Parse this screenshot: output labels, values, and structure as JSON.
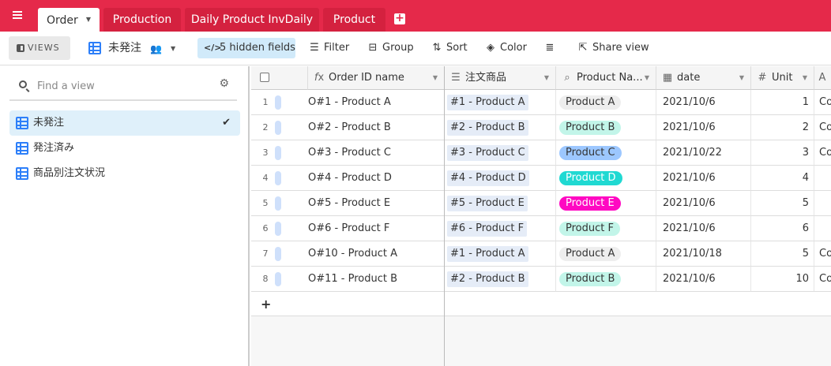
{
  "tabs": [
    {
      "label": "Order",
      "active": true
    },
    {
      "label": "Production",
      "active": false
    },
    {
      "label": "Daily Product InvDaily",
      "active": false
    },
    {
      "label": "Product",
      "active": false
    }
  ],
  "toolbar": {
    "views_label": "VIEWS",
    "view_name": "未発注",
    "hidden_fields": "5 hidden fields",
    "filter": "Filter",
    "group": "Group",
    "sort": "Sort",
    "color": "Color",
    "share": "Share view"
  },
  "sidebar": {
    "search_placeholder": "Find a view",
    "views": [
      {
        "label": "未発注",
        "active": true
      },
      {
        "label": "発注済み",
        "active": false
      },
      {
        "label": "商品別注文状況",
        "active": false
      }
    ]
  },
  "columns": [
    {
      "label": "Order ID name",
      "icon": "formula-icon"
    },
    {
      "label": "注文商品",
      "icon": "link-icon"
    },
    {
      "label": "Product Na...",
      "icon": "lookup-icon"
    },
    {
      "label": "date",
      "icon": "calendar-icon"
    },
    {
      "label": "Unit",
      "icon": "number-icon"
    },
    {
      "label": "",
      "icon": "text-icon"
    }
  ],
  "rows": [
    {
      "num": "1",
      "order": "O#1 - Product A",
      "link": "#1 - Product A",
      "product": "Product A",
      "date": "2021/10/6",
      "unit": "1",
      "extra": "Co"
    },
    {
      "num": "2",
      "order": "O#2 - Product B",
      "link": "#2 - Product B",
      "product": "Product B",
      "date": "2021/10/6",
      "unit": "2",
      "extra": "Co"
    },
    {
      "num": "3",
      "order": "O#3 - Product C",
      "link": "#3 - Product C",
      "product": "Product C",
      "date": "2021/10/22",
      "unit": "3",
      "extra": "Co"
    },
    {
      "num": "4",
      "order": "O#4 - Product D",
      "link": "#4 - Product D",
      "product": "Product D",
      "date": "2021/10/6",
      "unit": "4",
      "extra": ""
    },
    {
      "num": "5",
      "order": "O#5 - Product E",
      "link": "#5 - Product E",
      "product": "Product E",
      "date": "2021/10/6",
      "unit": "5",
      "extra": ""
    },
    {
      "num": "6",
      "order": "O#6 - Product F",
      "link": "#6 - Product F",
      "product": "Product F",
      "date": "2021/10/6",
      "unit": "6",
      "extra": ""
    },
    {
      "num": "7",
      "order": "O#10 - Product A",
      "link": "#1 - Product A",
      "product": "Product A",
      "date": "2021/10/18",
      "unit": "5",
      "extra": "Co"
    },
    {
      "num": "8",
      "order": "O#11 - Product B",
      "link": "#2 - Product B",
      "product": "Product B",
      "date": "2021/10/6",
      "unit": "10",
      "extra": "Co"
    }
  ],
  "product_colors": {
    "Product A": {
      "bg": "#eeeeee",
      "fg": "#333333"
    },
    "Product B": {
      "bg": "#c2f5e9",
      "fg": "#333333"
    },
    "Product C": {
      "bg": "#9cc7ff",
      "fg": "#333333"
    },
    "Product D": {
      "bg": "#20d9d2",
      "fg": "#ffffff"
    },
    "Product E": {
      "bg": "#ff08c2",
      "fg": "#ffffff"
    },
    "Product F": {
      "bg": "#c2f5e9",
      "fg": "#333333"
    }
  },
  "add_row_label": "+"
}
